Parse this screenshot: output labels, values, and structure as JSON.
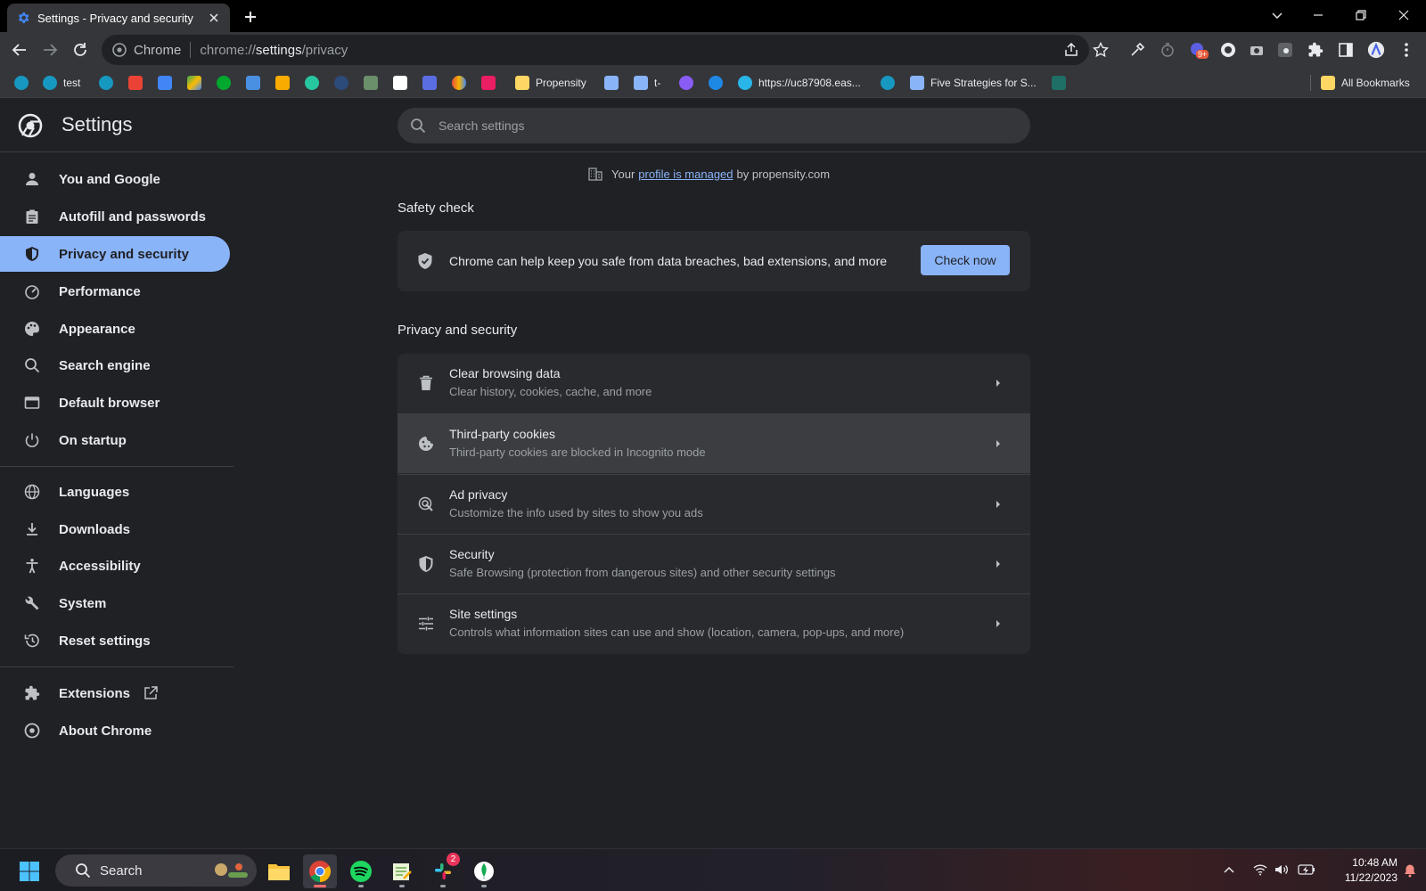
{
  "window": {
    "tab_title": "Settings - Privacy and security",
    "new_tab_label": "+"
  },
  "toolbar": {
    "site_name": "Chrome",
    "url_scheme": "chrome://",
    "url_host": "settings",
    "url_path": "/privacy",
    "extension_badge": "9+"
  },
  "bookmarks": {
    "items": [
      {
        "label": "",
        "icon": "salesforce-cloud-icon",
        "color": "#1798c1"
      },
      {
        "label": "test",
        "icon": "salesforce-cloud-icon",
        "color": "#1798c1"
      },
      {
        "label": "",
        "icon": "salesforce-cloud-icon",
        "color": "#1798c1"
      },
      {
        "label": "",
        "icon": "gmail-icon",
        "color": "#ea4335"
      },
      {
        "label": "",
        "icon": "calendar-icon",
        "color": "#4285f4"
      },
      {
        "label": "",
        "icon": "drive-icon",
        "color": "#34a853"
      },
      {
        "label": "",
        "icon": "evernote-icon",
        "color": "#00a82d"
      },
      {
        "label": "",
        "icon": "a-logo-icon",
        "color": "#4a90e2"
      },
      {
        "label": "",
        "icon": "analytics-icon",
        "color": "#f9ab00"
      },
      {
        "label": "",
        "icon": "swirl-icon",
        "color": "#26c6a0"
      },
      {
        "label": "",
        "icon": "circle-logo-icon",
        "color": "#2c4a7a"
      },
      {
        "label": "",
        "icon": "image-icon",
        "color": "#6b8e6b"
      },
      {
        "label": "",
        "icon": "g-logo-icon",
        "color": "#ffffff"
      },
      {
        "label": "",
        "icon": "cloud-box-icon",
        "color": "#5b6ee1"
      },
      {
        "label": "",
        "icon": "cloud-multi-icon",
        "color": "#e94c3d"
      },
      {
        "label": "",
        "icon": "square-logo-icon",
        "color": "#e91e63"
      },
      {
        "label": "Propensity",
        "icon": "folder-icon",
        "color": "#fdd663"
      },
      {
        "label": "",
        "icon": "a-logo-icon",
        "color": "#8ab4f8"
      },
      {
        "label": "t-",
        "icon": "a-logo-icon",
        "color": "#8ab4f8"
      },
      {
        "label": "",
        "icon": "loop-icon",
        "color": "#8a5cf6"
      },
      {
        "label": "",
        "icon": "t-logo-icon",
        "color": "#1e88e5"
      },
      {
        "label": "https://uc87908.eas...",
        "icon": "snowflake-icon",
        "color": "#29b5e8"
      },
      {
        "label": "",
        "icon": "salesforce-cloud-icon",
        "color": "#1798c1"
      },
      {
        "label": "Five Strategies for S...",
        "icon": "a-logo-icon",
        "color": "#8ab4f8"
      },
      {
        "label": "",
        "icon": "z-logo-icon",
        "color": "#1f6f66"
      }
    ],
    "all_bookmarks_label": "All Bookmarks"
  },
  "settings": {
    "title": "Settings",
    "search_placeholder": "Search settings"
  },
  "sidebar": {
    "items": [
      {
        "label": "You and Google",
        "icon": "person-icon",
        "active": false
      },
      {
        "label": "Autofill and passwords",
        "icon": "clipboard-icon",
        "active": false
      },
      {
        "label": "Privacy and security",
        "icon": "shield-icon",
        "active": true
      },
      {
        "label": "Performance",
        "icon": "speedometer-icon",
        "active": false
      },
      {
        "label": "Appearance",
        "icon": "palette-icon",
        "active": false
      },
      {
        "label": "Search engine",
        "icon": "search-icon",
        "active": false
      },
      {
        "label": "Default browser",
        "icon": "browser-icon",
        "active": false
      },
      {
        "label": "On startup",
        "icon": "power-icon",
        "active": false
      },
      {
        "label": "Languages",
        "icon": "globe-icon",
        "active": false
      },
      {
        "label": "Downloads",
        "icon": "download-icon",
        "active": false
      },
      {
        "label": "Accessibility",
        "icon": "accessibility-icon",
        "active": false
      },
      {
        "label": "System",
        "icon": "wrench-icon",
        "active": false
      },
      {
        "label": "Reset settings",
        "icon": "history-icon",
        "active": false
      },
      {
        "label": "Extensions",
        "icon": "puzzle-icon",
        "active": false
      },
      {
        "label": "About Chrome",
        "icon": "chrome-icon",
        "active": false
      }
    ]
  },
  "main": {
    "managed_prefix": "Your",
    "managed_link": "profile is managed",
    "managed_suffix": "by propensity.com",
    "safety_check": {
      "title": "Safety check",
      "text": "Chrome can help keep you safe from data breaches, bad extensions, and more",
      "button": "Check now"
    },
    "privacy": {
      "title": "Privacy and security",
      "rows": [
        {
          "title": "Clear browsing data",
          "subtitle": "Clear history, cookies, cache, and more",
          "icon": "trash-icon"
        },
        {
          "title": "Third-party cookies",
          "subtitle": "Third-party cookies are blocked in Incognito mode",
          "icon": "cookie-icon"
        },
        {
          "title": "Ad privacy",
          "subtitle": "Customize the info used by sites to show you ads",
          "icon": "ad-privacy-icon"
        },
        {
          "title": "Security",
          "subtitle": "Safe Browsing (protection from dangerous sites) and other security settings",
          "icon": "shield-icon"
        },
        {
          "title": "Site settings",
          "subtitle": "Controls what information sites can use and show (location, camera, pop-ups, and more)",
          "icon": "tune-icon"
        }
      ]
    }
  },
  "taskbar": {
    "search_label": "Search",
    "slack_badge": "2",
    "time": "10:48 AM",
    "date": "11/22/2023"
  },
  "colors": {
    "accent": "#8ab4f8",
    "background": "#202124",
    "card": "#292a2d"
  }
}
